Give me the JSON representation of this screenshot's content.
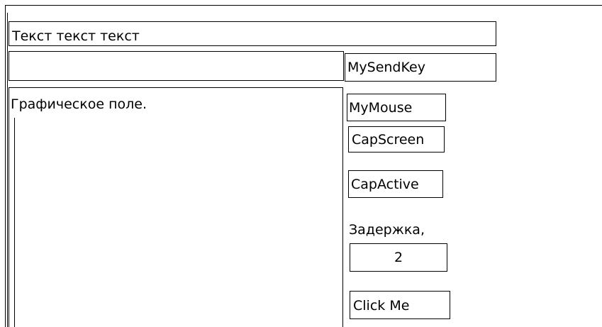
{
  "header": {
    "title_text": "Текст текст текст"
  },
  "input_row": {
    "text_value": "",
    "send_key_label": "MySendKey"
  },
  "graphic_area": {
    "label": "Графическое  поле."
  },
  "controls": {
    "mouse_label": "MyMouse",
    "cap_screen_label": "CapScreen",
    "cap_active_label": "CapActive",
    "delay_label": "Задержка,",
    "delay_value": "2",
    "click_me_label": "Click Me"
  }
}
